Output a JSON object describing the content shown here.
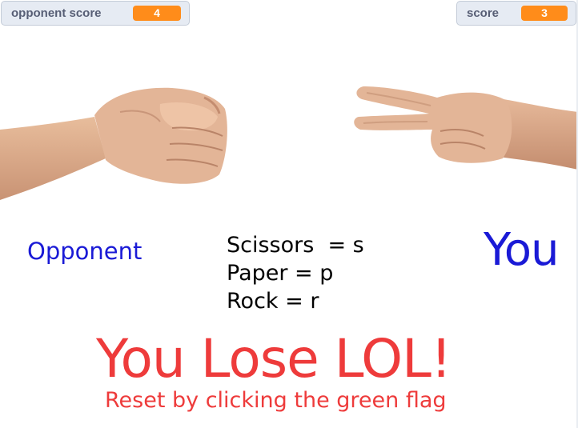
{
  "monitors": {
    "opponent": {
      "label": "opponent score",
      "value": "4"
    },
    "player": {
      "label": "score",
      "value": "3"
    }
  },
  "hands": {
    "opponent": {
      "icon": "rock-fist-icon",
      "choice": "rock"
    },
    "player": {
      "icon": "scissors-hand-icon",
      "choice": "scissors"
    }
  },
  "labels": {
    "opponent": "Opponent",
    "you": "You"
  },
  "instructions": [
    "Scissors  = s",
    "Paper = p",
    "Rock = r"
  ],
  "result": {
    "text": "You Lose LOL!",
    "reset": "Reset by clicking the green flag"
  },
  "colors": {
    "monitor_value": "#ff8c1a",
    "player_labels": "#1a1ad6",
    "result_text": "#ee3b3b",
    "skin": "#e2b393"
  }
}
